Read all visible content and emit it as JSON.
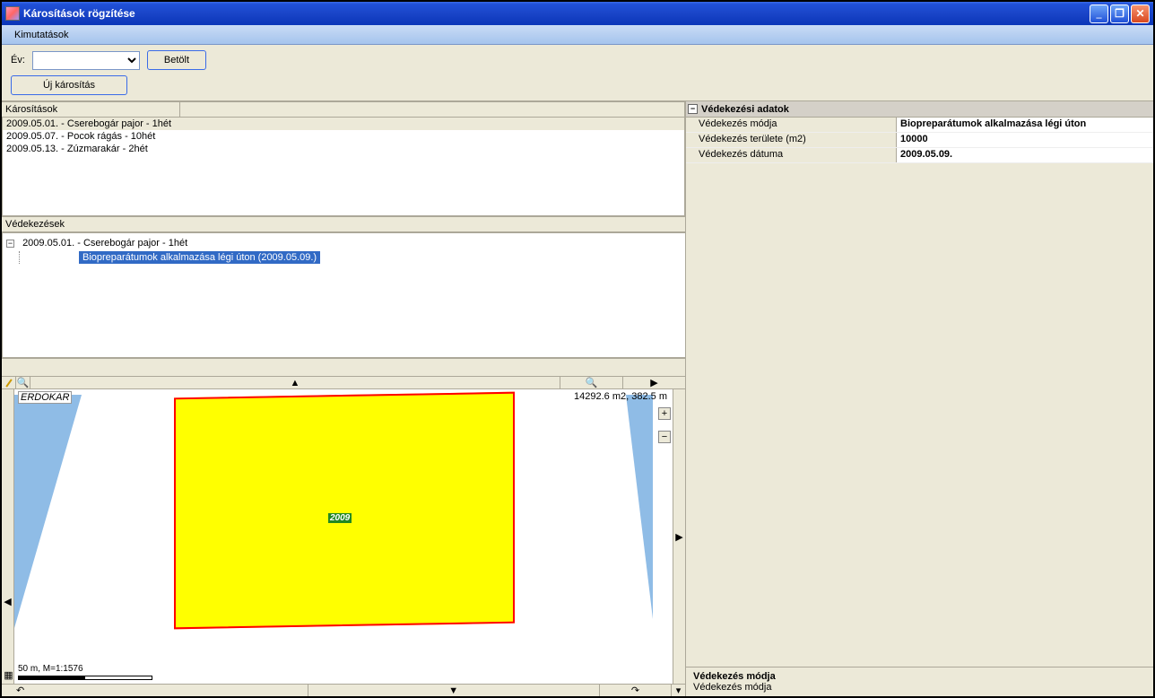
{
  "window": {
    "title": "Károsítások rögzítése"
  },
  "menubar": {
    "item1": "Kimutatások"
  },
  "toolbar": {
    "year_label": "Év:",
    "load_btn": "Betölt",
    "new_btn": "Új károsítás"
  },
  "damage_panel": {
    "header": "Károsítások",
    "items": [
      "2009.05.01. - Cserebogár pajor - 1hét",
      "2009.05.07. - Pocok rágás - 10hét",
      "2009.05.13. - Zúzmarakár - 2hét"
    ]
  },
  "defense_panel": {
    "header": "Védekezések",
    "tree_parent": "2009.05.01. - Cserebogár pajor - 1hét",
    "tree_child": "Biopreparátumok alkalmazása légi úton (2009.05.09.)"
  },
  "map": {
    "layer_name": "ERDOKAR",
    "area_text": "14292.6 m2, 382.5 m",
    "parcel_year": "2009",
    "scale_text": "50 m, M=1:1576",
    "zoom_in": "+",
    "zoom_out": "−",
    "magnify": "🔍"
  },
  "props": {
    "header": "Védekezési adatok",
    "rows": [
      {
        "label": "Védekezés módja",
        "value": "Biopreparátumok alkalmazása légi úton"
      },
      {
        "label": "Védekezés területe (m2)",
        "value": "10000"
      },
      {
        "label": "Védekezés dátuma",
        "value": "2009.05.09."
      }
    ],
    "footer_title": "Védekezés módja",
    "footer_desc": "Védekezés módja"
  }
}
